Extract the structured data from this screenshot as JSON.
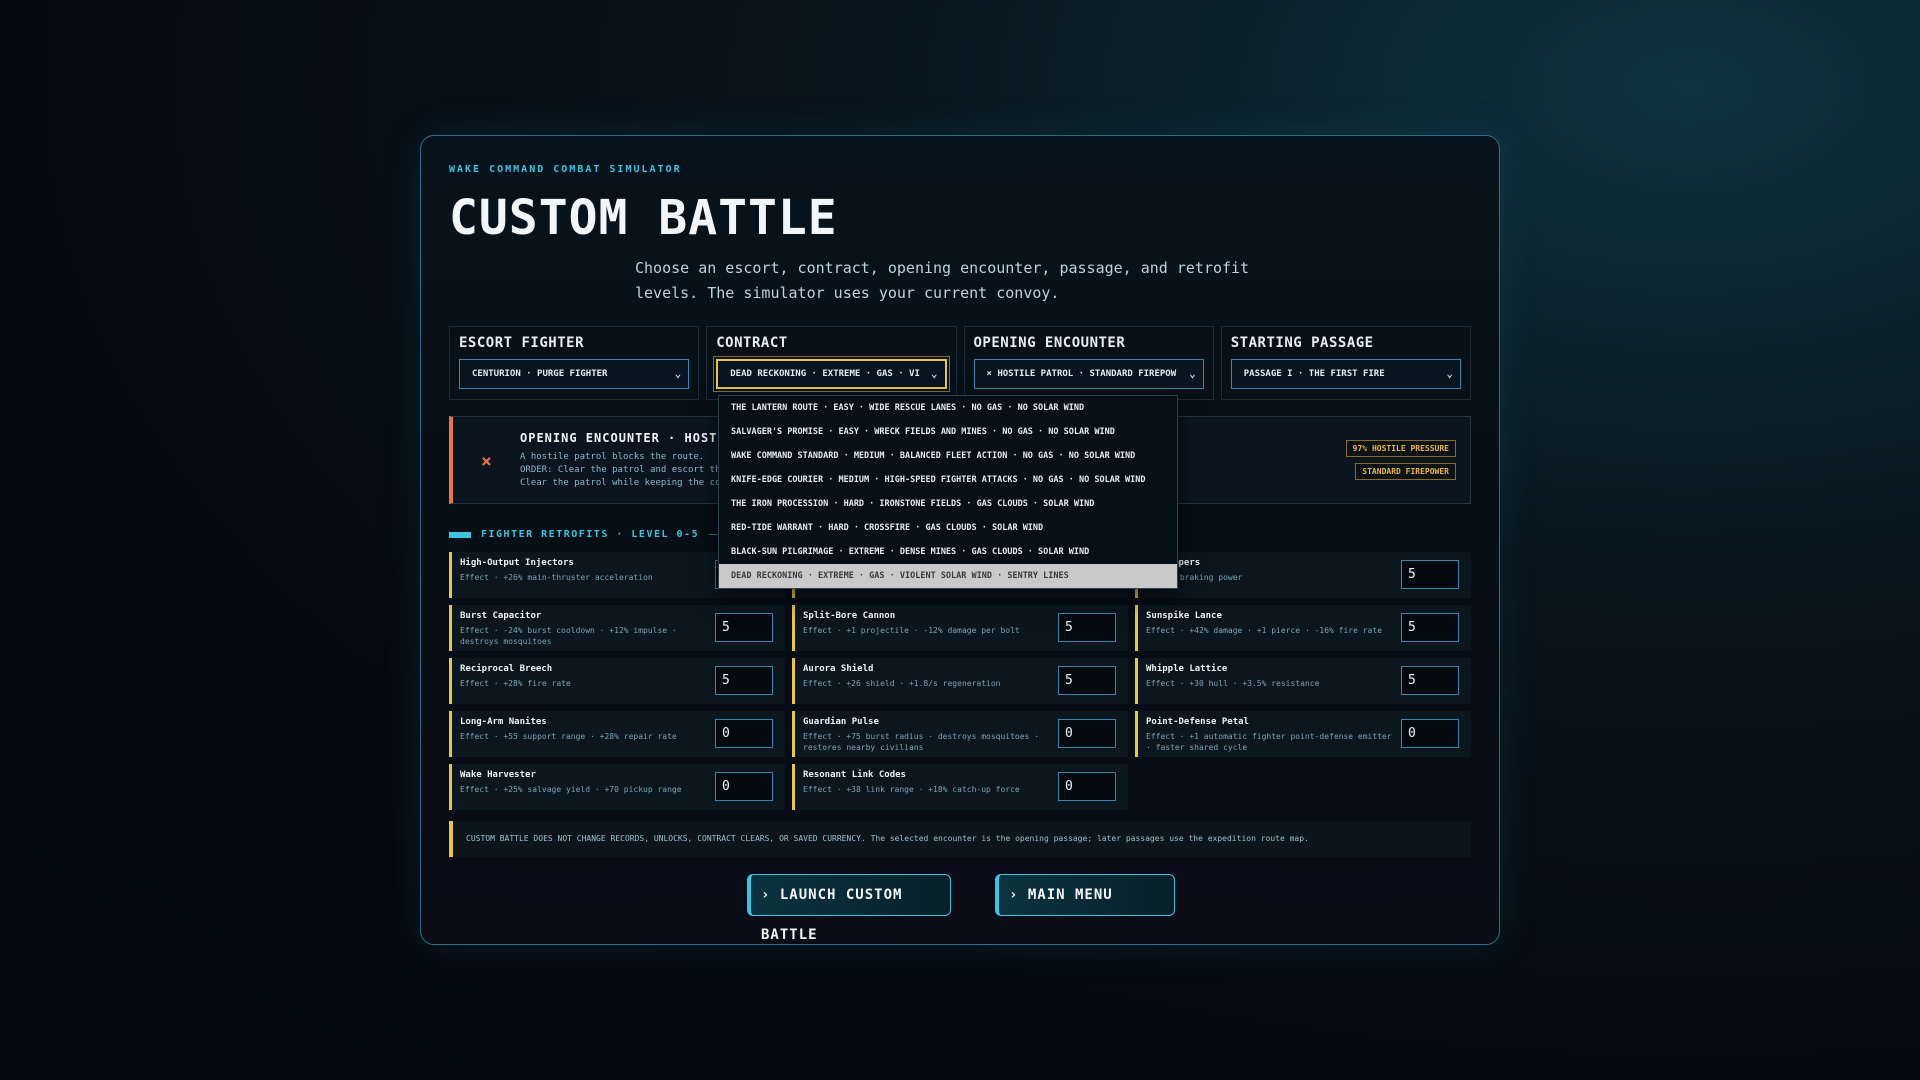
{
  "eyebrow": "WAKE COMMAND COMBAT SIMULATOR",
  "title": "CUSTOM BATTLE",
  "subtitle": "Choose an escort, contract, opening encounter, passage, and retrofit levels. The simulator uses your current convoy.",
  "selectors": [
    {
      "label": "ESCORT FIGHTER",
      "value": "CENTURION · PURGE FIGHTER"
    },
    {
      "label": "CONTRACT",
      "value": "DEAD RECKONING · EXTREME · GAS · VI"
    },
    {
      "label": "OPENING ENCOUNTER",
      "value": "× HOSTILE PATROL · STANDARD FIREPOW"
    },
    {
      "label": "STARTING PASSAGE",
      "value": "PASSAGE I · THE FIRST FIRE"
    }
  ],
  "encounter": {
    "icon": "×",
    "title": "OPENING ENCOUNTER · HOSTI",
    "desc1": "A hostile patrol blocks the route.",
    "desc2": "ORDER: Clear the patrol and escort the c",
    "desc3": "Clear the patrol while keeping the convo",
    "badge_pressure": "97% HOSTILE PRESSURE",
    "badge_firepower": "STANDARD FIREPOWER"
  },
  "retrofits_heading": "FIGHTER RETROFITS · LEVEL 0-5",
  "retrofits": [
    {
      "name": "High-Output Injectors",
      "effect": "Effect · +26% main-thruster acceleration",
      "level": "5"
    },
    {
      "name": "",
      "effect": "",
      "level": ""
    },
    {
      "name": "al Dampers",
      "effect": "· +45% braking power",
      "level": "5"
    },
    {
      "name": "Burst Capacitor",
      "effect": "Effect · -24% burst cooldown · +12% impulse · destroys mosquitoes",
      "level": "5"
    },
    {
      "name": "Split-Bore Cannon",
      "effect": "Effect · +1 projectile · -12% damage per bolt",
      "level": "5"
    },
    {
      "name": "Sunspike Lance",
      "effect": "Effect · +42% damage · +1 pierce · -16% fire rate",
      "level": "5"
    },
    {
      "name": "Reciprocal Breech",
      "effect": "Effect · +28% fire rate",
      "level": "5"
    },
    {
      "name": "Aurora Shield",
      "effect": "Effect · +26 shield · +1.8/s regeneration",
      "level": "5"
    },
    {
      "name": "Whipple Lattice",
      "effect": "Effect · +30 hull · +3.5% resistance",
      "level": "5"
    },
    {
      "name": "Long-Arm Nanites",
      "effect": "Effect · +55 support range · +28% repair rate",
      "level": "0"
    },
    {
      "name": "Guardian Pulse",
      "effect": "Effect · +75 burst radius · destroys mosquitoes · restores nearby civilians",
      "level": "0"
    },
    {
      "name": "Point-Defense Petal",
      "effect": "Effect · +1 automatic fighter point-defense emitter · faster shared cycle",
      "level": "0"
    },
    {
      "name": "Wake Harvester",
      "effect": "Effect · +25% salvage yield · +70 pickup range",
      "level": "0"
    },
    {
      "name": "Resonant Link Codes",
      "effect": "Effect · +38 link range · +18% catch-up force",
      "level": "0"
    }
  ],
  "notice": "CUSTOM BATTLE DOES NOT CHANGE RECORDS, UNLOCKS, CONTRACT CLEARS, OR SAVED CURRENCY. The selected encounter is the opening passage; later passages use the expedition route map.",
  "buttons": {
    "launch": "› LAUNCH CUSTOM BATTLE",
    "menu": "› MAIN MENU"
  },
  "contract_options": [
    "THE LANTERN ROUTE · EASY · WIDE RESCUE LANES · NO GAS · NO SOLAR WIND",
    "SALVAGER'S PROMISE · EASY · WRECK FIELDS AND MINES · NO GAS · NO SOLAR WIND",
    "WAKE COMMAND STANDARD · MEDIUM · BALANCED FLEET ACTION · NO GAS · NO SOLAR WIND",
    "KNIFE-EDGE COURIER · MEDIUM · HIGH-SPEED FIGHTER ATTACKS · NO GAS · NO SOLAR WIND",
    "THE IRON PROCESSION · HARD · IRONSTONE FIELDS · GAS CLOUDS · SOLAR WIND",
    "RED-TIDE WARRANT · HARD · CROSSFIRE · GAS CLOUDS · SOLAR WIND",
    "BLACK-SUN PILGRIMAGE · EXTREME · DENSE MINES · GAS CLOUDS · SOLAR WIND",
    "DEAD RECKONING · EXTREME · GAS · VIOLENT SOLAR WIND · SENTRY LINES"
  ],
  "selected_contract_index": 7,
  "chevron": "⌄",
  "colors": {
    "accent": "#3fc4e0",
    "warning": "#e8c64a",
    "danger": "#e8744a"
  }
}
